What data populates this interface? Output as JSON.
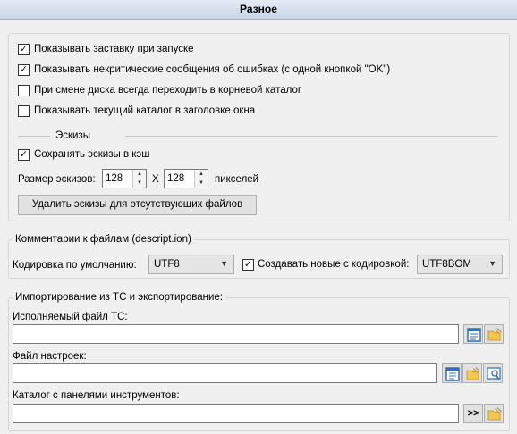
{
  "header": {
    "title": "Разное"
  },
  "general": {
    "show_splash": {
      "label": "Показывать заставку при запуске",
      "checked": true
    },
    "show_noncritical": {
      "label": "Показывать некритические сообщения об ошибках (с одной кнопкой \"OK\")",
      "checked": true
    },
    "goto_root": {
      "label": "При смене диска всегда переходить в корневой каталог",
      "checked": false
    },
    "show_dir_title": {
      "label": "Показывать текущий каталог в заголовке окна",
      "checked": false
    }
  },
  "thumbnails": {
    "section_label": "Эскизы",
    "save_cache": {
      "label": "Сохранять эскизы в кэш",
      "checked": true
    },
    "size_label": "Размер эскизов:",
    "width": "128",
    "x_label": "X",
    "height": "128",
    "pixels_label": "пикселей",
    "delete_button": "Удалить эскизы для отсутствующих файлов"
  },
  "comments": {
    "group_title": "Комментарии к файлам (descript.ion)",
    "default_encoding_label": "Кодировка по умолчанию:",
    "default_encoding_value": "UTF8",
    "create_new": {
      "label": "Создавать новые с кодировкой:",
      "checked": true
    },
    "new_encoding_value": "UTF8BOM"
  },
  "import_export": {
    "group_title": "Импортирование из TC и экспортирование:",
    "tc_exe_label": "Исполняемый файл TC:",
    "tc_exe_value": "",
    "config_label": "Файл настроек:",
    "config_value": "",
    "toolbar_dir_label": "Каталог с панелями инструментов:",
    "toolbar_dir_value": "",
    "arrow_button": ">>"
  },
  "icons": {
    "view": "view-file-icon",
    "browse": "folder-open-icon",
    "search": "find-file-icon"
  },
  "colors": {
    "header_top": "#e4ebf4",
    "header_bottom": "#c9d6e6",
    "icon_blue": "#2f6fb8",
    "folder_yellow": "#f2c94c"
  }
}
